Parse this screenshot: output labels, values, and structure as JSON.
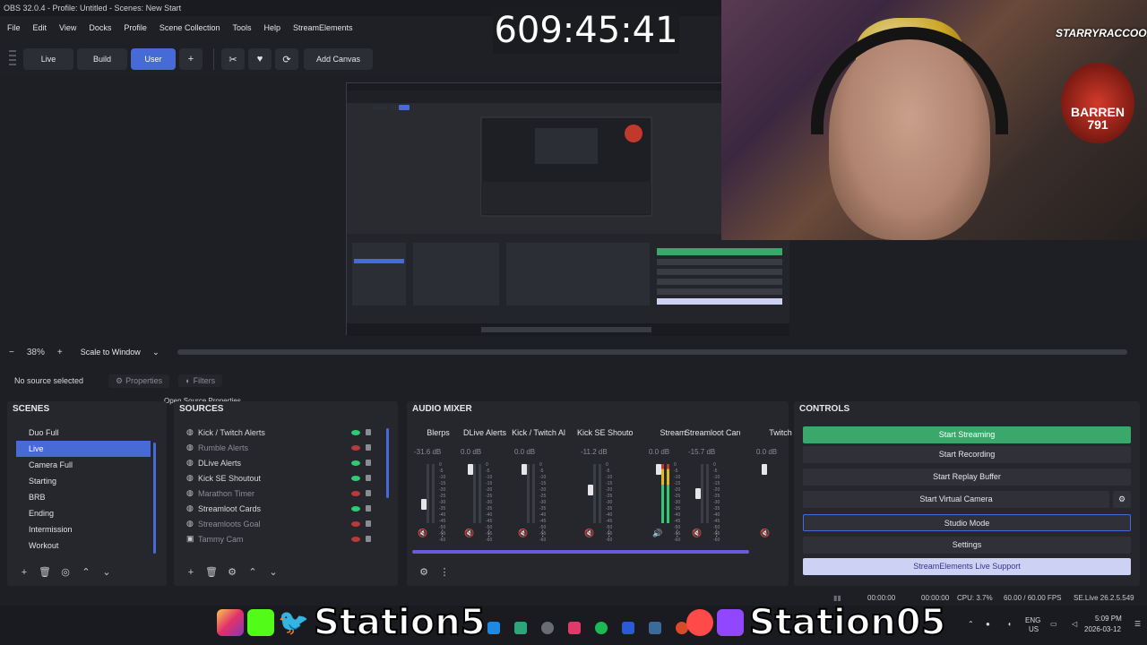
{
  "titlebar": {
    "text": "OBS 32.0.4 - Profile: Untitled - Scenes: New Start"
  },
  "menu": [
    "File",
    "Edit",
    "View",
    "Docks",
    "Profile",
    "Scene Collection",
    "Tools",
    "Help",
    "StreamElements"
  ],
  "toolbar": {
    "buttons": [
      "Live",
      "Build",
      "User",
      "+"
    ],
    "active": "User",
    "icons": [
      "scissors-icon",
      "heart-icon",
      "refresh-icon"
    ],
    "add_canvas": "Add Canvas"
  },
  "timer": "609:45:41",
  "zoom": {
    "minus": "−",
    "value": "38%",
    "plus": "+",
    "scale_mode": "Scale to Window"
  },
  "context": {
    "no_source": "No source selected",
    "properties": "Properties",
    "filters": "Filters",
    "tooltip": "Open Source Properties"
  },
  "scenes": {
    "title": "SCENES",
    "items": [
      "Duo Full",
      "Live",
      "Camera Full",
      "Starting",
      "BRB",
      "Ending",
      "Intermission",
      "Workout"
    ],
    "selected": "Live"
  },
  "sources": {
    "title": "SOURCES",
    "items": [
      {
        "icon": "globe",
        "name": "Kick / Twitch Alerts",
        "visible": true
      },
      {
        "icon": "globe",
        "name": "Rumble Alerts",
        "visible": false
      },
      {
        "icon": "globe",
        "name": "DLive Alerts",
        "visible": true
      },
      {
        "icon": "globe",
        "name": "Kick SE Shoutout",
        "visible": true
      },
      {
        "icon": "globe",
        "name": "Marathon Timer",
        "visible": false
      },
      {
        "icon": "globe",
        "name": "Streamloot Cards",
        "visible": true
      },
      {
        "icon": "globe",
        "name": "Streamloots Goal",
        "visible": false
      },
      {
        "icon": "camera",
        "name": "Tammy Cam",
        "visible": false
      }
    ]
  },
  "mixer": {
    "title": "AUDIO MIXER",
    "channels": [
      {
        "name": "Blerps",
        "db": "-31.6 dB",
        "muted": true,
        "level": 0.35
      },
      {
        "name": "DLive Alerts",
        "db": "0.0 dB",
        "muted": true,
        "level": 1.0
      },
      {
        "name": "Kick / Twitch Al",
        "db": "0.0 dB",
        "muted": true,
        "level": 1.0
      },
      {
        "name": "Kick SE Shoutou",
        "db": "-11.2 dB",
        "muted": true,
        "level": 0.62
      },
      {
        "name": "Stream",
        "db": "0.0 dB",
        "muted": false,
        "level": 1.0
      },
      {
        "name": "Streamloot Card",
        "db": "-15.7 dB",
        "muted": true,
        "level": 0.55
      },
      {
        "name": "Twitch",
        "db": "0.0 dB",
        "muted": true,
        "level": 1.0
      }
    ],
    "scale": [
      "0",
      "-5",
      "-10",
      "-15",
      "-20",
      "-25",
      "-30",
      "-35",
      "-40",
      "-45",
      "-50",
      "-55",
      "-60"
    ]
  },
  "controls": {
    "title": "CONTROLS",
    "start_streaming": "Start Streaming",
    "start_recording": "Start Recording",
    "start_replay": "Start Replay Buffer",
    "start_virtual": "Start Virtual Camera",
    "studio_mode": "Studio Mode",
    "settings": "Settings",
    "support": "StreamElements Live Support"
  },
  "status": {
    "time1": "00:00:00",
    "time2": "00:00:00",
    "cpu": "CPU: 3.7%",
    "fps": "60.00 / 60.00 FPS",
    "version": "SE.Live 26.2.5.549"
  },
  "overlay": {
    "name1": "Station5",
    "name2": "Station05"
  },
  "webcam": {
    "logo_top": "STARRYRACCOON",
    "logo_bottom": "BARREN 791"
  },
  "tray": {
    "lang1": "ENG",
    "lang2": "US",
    "time": "5:09 PM",
    "date": "2026-03-12"
  },
  "colors": {
    "accent": "#476bd6",
    "stream": "#3aa86b",
    "support_bg": "#cdd2f5"
  }
}
